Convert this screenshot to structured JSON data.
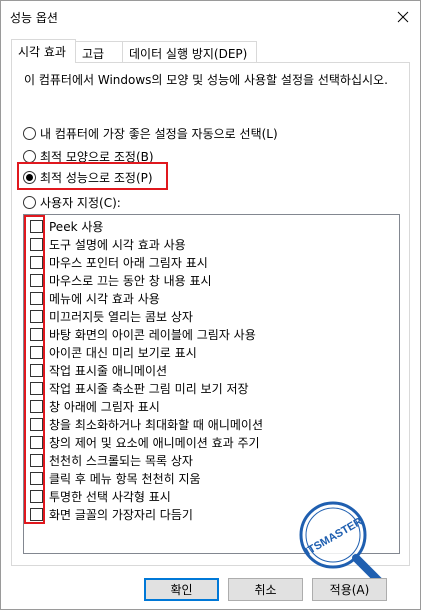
{
  "window": {
    "title": "성능 옵션"
  },
  "tabs": [
    {
      "label": "시각 효과",
      "active": true
    },
    {
      "label": "고급",
      "active": false
    },
    {
      "label": "데이터 실행 방지(DEP)",
      "active": false
    }
  ],
  "description": "이 컴퓨터에서 Windows의 모양 및 성능에 사용할 설정을 선택하십시오.",
  "radios": [
    {
      "label": "내 컴퓨터에 가장 좋은 설정을 자동으로 선택(L)",
      "checked": false
    },
    {
      "label": "최적 모양으로 조정(B)",
      "checked": false
    },
    {
      "label": "최적 성능으로 조정(P)",
      "checked": true
    },
    {
      "label": "사용자 지정(C):",
      "checked": false
    }
  ],
  "effects": [
    "Peek 사용",
    "도구 설명에 시각 효과 사용",
    "마우스 포인터 아래 그림자 표시",
    "마우스로 끄는 동안 창 내용 표시",
    "메뉴에 시각 효과 사용",
    "미끄러지듯 열리는 콤보 상자",
    "바탕 화면의 아이콘 레이블에 그림자 사용",
    "아이콘 대신 미리 보기로 표시",
    "작업 표시줄 애니메이션",
    "작업 표시줄 축소판 그림 미리 보기 저장",
    "창 아래에 그림자 표시",
    "창을 최소화하거나 최대화할 때 애니메이션",
    "창의 제어 및 요소에 애니메이션 효과 주기",
    "천천히 스크롤되는 목록 상자",
    "클릭 후 메뉴 항목 천천히 지움",
    "투명한 선택 사각형 표시",
    "화면 글꼴의 가장자리 다듬기"
  ],
  "buttons": {
    "ok": "확인",
    "cancel": "취소",
    "apply": "적용(A)"
  },
  "watermark": {
    "text": "ITSMASTER"
  },
  "colors": {
    "highlight": "#e0181e",
    "watermark": "#1f5fb0"
  }
}
